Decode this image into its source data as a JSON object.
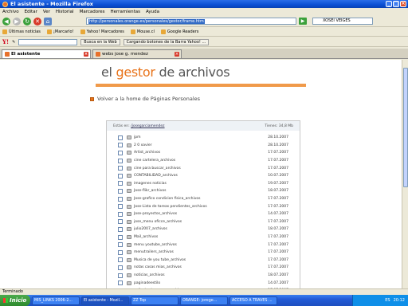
{
  "window": {
    "title": "El asistente - Mozilla Firefox"
  },
  "menu": [
    "Archivo",
    "Editar",
    "Ver",
    "Historial",
    "Marcadores",
    "Herramientas",
    "Ayuda"
  ],
  "nav": {
    "url_prefix": "http://",
    "url": "personales.orange.es/personales/gestor/frame.htm",
    "search_value": "XOSEI VEIGES"
  },
  "bookmarks": [
    "Últimas noticias",
    "¡Marcarlo!",
    "Yahoo! Marcadores",
    "Mouse.cl",
    "Google Readers"
  ],
  "yahoo": {
    "search_button": "Busca en la Web",
    "loading_text": "Cargando botones de la Barra Yahoo! ..."
  },
  "tabs": [
    {
      "label": "El asistente"
    },
    {
      "label": "webs jose g. mendez"
    }
  ],
  "page": {
    "logo_prefix": "el ",
    "logo_accent": "gestor",
    "logo_suffix": " de archivos",
    "back_link": "Volver a la home de Páginas Personales",
    "panel": {
      "path_label": "Estás en: ",
      "path": "/josegarciamendez",
      "size_label": "Tienes: ",
      "size": "34,8 Mb"
    },
    "files": [
      {
        "name": "jpm",
        "date": "28.10.2007"
      },
      {
        "name": "2 0 xavier",
        "date": "28.10.2007"
      },
      {
        "name": "Artist_archivos",
        "date": "17.07.2007"
      },
      {
        "name": "cine cartelera_archivos",
        "date": "17.07.2007"
      },
      {
        "name": "cine para buscar_archivos",
        "date": "17.07.2007"
      },
      {
        "name": "CONTABILIDAD_archivos",
        "date": "10.07.2007"
      },
      {
        "name": "imagenes noticias",
        "date": "19.07.2007"
      },
      {
        "name": "Jose-flikr_archivos",
        "date": "18.07.2007"
      },
      {
        "name": "Jose-grafico condicion fisica_archivos",
        "date": "17.07.2007"
      },
      {
        "name": "Jose-Lista de tareas pendientes_archivos",
        "date": "17.07.2007"
      },
      {
        "name": "Jose-proyectos_archivos",
        "date": "14.07.2007"
      },
      {
        "name": "jose_menu oficce_archivos",
        "date": "17.07.2007"
      },
      {
        "name": "julio2007_archivos",
        "date": "18.07.2007"
      },
      {
        "name": "Mail_archivos",
        "date": "17.07.2007"
      },
      {
        "name": "menu youtube_archivos",
        "date": "17.07.2007"
      },
      {
        "name": "menutrailers_archivos",
        "date": "17.07.2007"
      },
      {
        "name": "Musica de you tube_archivos",
        "date": "17.07.2007"
      },
      {
        "name": "notas casas mias_archivos",
        "date": "17.07.2007"
      },
      {
        "name": "noticias_archivos",
        "date": "18.07.2007"
      },
      {
        "name": "paginadeestilo",
        "date": "14.07.2007"
      },
      {
        "name": "peliculasdescargas_archivos",
        "date": "17.07.2007"
      }
    ]
  },
  "status": {
    "text": "Terminado"
  },
  "taskbar": {
    "start": "Inicio",
    "buttons": [
      "MIS_LINKS 2006-2...",
      "El asistente - Mozil...",
      "ZZ Top",
      "ORANGE: jorege...",
      "ACCESO A TRAVES ..."
    ],
    "lang": "ES",
    "time": "20:12"
  },
  "colors": {
    "accent": "#e8731a",
    "titlebar": "#0a4fd4"
  }
}
